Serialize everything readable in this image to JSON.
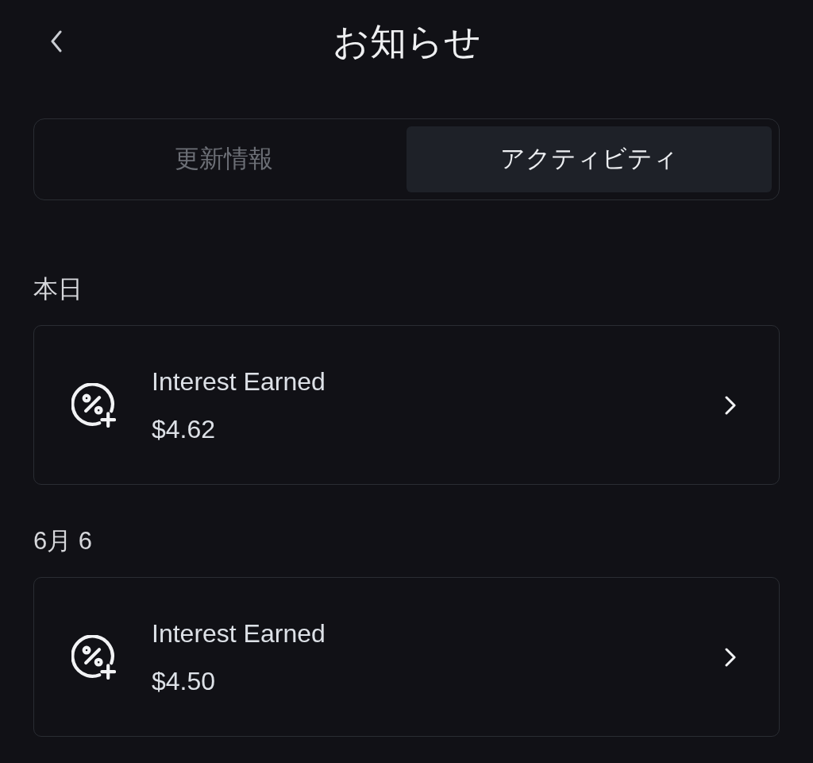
{
  "header": {
    "title": "お知らせ"
  },
  "tabs": [
    {
      "label": "更新情報",
      "selected": false
    },
    {
      "label": "アクティビティ",
      "selected": true
    }
  ],
  "sections": [
    {
      "heading": "本日",
      "items": [
        {
          "title": "Interest Earned",
          "amount": "$4.62"
        }
      ]
    },
    {
      "heading": "6月 6",
      "items": [
        {
          "title": "Interest Earned",
          "amount": "$4.50"
        }
      ]
    }
  ]
}
